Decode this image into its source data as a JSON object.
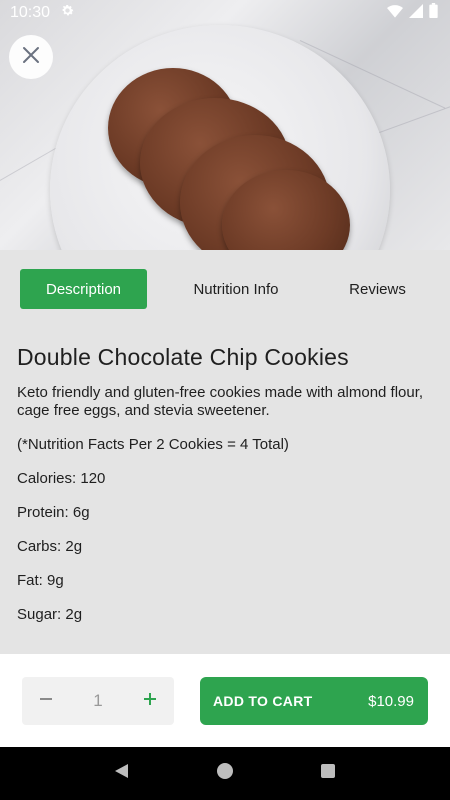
{
  "status_bar": {
    "time": "10:30",
    "icons": [
      "settings-icon",
      "wifi-icon",
      "signal-icon",
      "battery-icon"
    ]
  },
  "hero": {
    "image_alt": "Plate of double chocolate chip cookies",
    "close_icon": "close-icon"
  },
  "tabs": [
    {
      "label": "Description",
      "active": true
    },
    {
      "label": "Nutrition Info",
      "active": false
    },
    {
      "label": "Reviews",
      "active": false
    }
  ],
  "product": {
    "title": "Double Chocolate Chip Cookies",
    "description": "Keto friendly and gluten-free cookies made with almond flour, cage free eggs, and stevia sweetener.",
    "serving_note": "(*Nutrition Facts Per 2 Cookies = 4 Total)",
    "facts": [
      "Calories: 120",
      "Protein: 6g",
      "Carbs: 2g",
      "Fat: 9g",
      "Sugar: 2g"
    ]
  },
  "cart": {
    "quantity": "1",
    "add_label": "ADD TO CART",
    "price": "$10.99"
  },
  "colors": {
    "accent": "#2ea44f",
    "background": "#e4e4e4",
    "text": "#1f1f1f"
  },
  "nav": [
    "back-icon",
    "home-icon",
    "recents-icon"
  ]
}
